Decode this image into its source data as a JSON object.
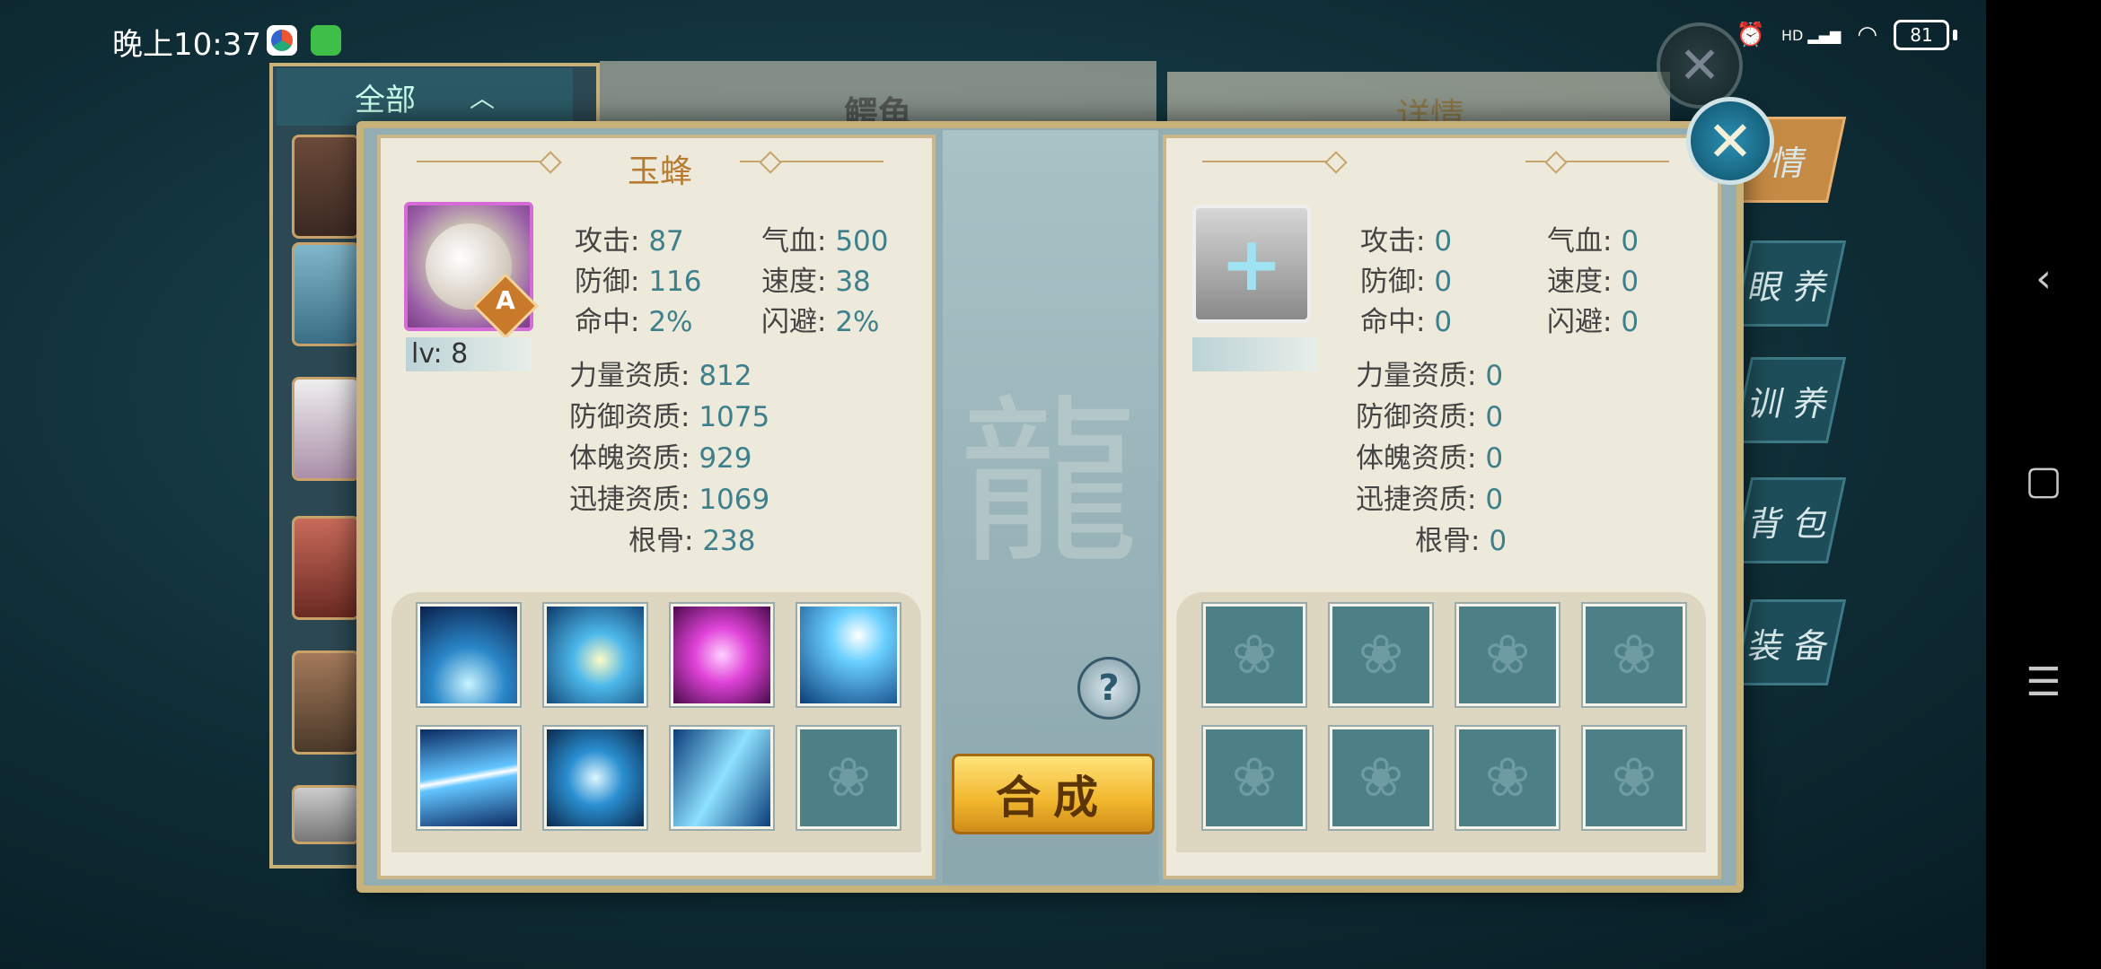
{
  "status_bar": {
    "time": "晚上10:37",
    "signal_label": "HD",
    "battery": "81"
  },
  "navbar": {
    "back": "‹",
    "home": "▢",
    "menu": "☰"
  },
  "background": {
    "filter_label": "全部",
    "middle_title": "鳄龟",
    "right_title": "详情",
    "side_tabs": [
      "情",
      "眼 养",
      "训 养",
      "背 包",
      "装 备"
    ]
  },
  "left_panel": {
    "pet_name": "玉蜂",
    "grade": "A",
    "level": "lv: 8",
    "stats": {
      "attack_label": "攻击:",
      "attack": "87",
      "hp_label": "气血:",
      "hp": "500",
      "defense_label": "防御:",
      "defense": "116",
      "speed_label": "速度:",
      "speed": "38",
      "hit_label": "命中:",
      "hit": "2%",
      "dodge_label": "闪避:",
      "dodge": "2%"
    },
    "aptitudes": {
      "strength_label": "力量资质:",
      "strength": "812",
      "defense_apt_label": "防御资质:",
      "defense_apt": "1075",
      "physique_label": "体魄资质:",
      "physique": "929",
      "agility_label": "迅捷资质:",
      "agility": "1069",
      "bone_label": "根骨:",
      "bone": "238"
    },
    "skills": [
      "ice-burst",
      "shield-strike",
      "pink-vortex",
      "thunder-storm",
      "blade-wind",
      "cross-blade",
      "swift-arrow",
      "empty"
    ]
  },
  "right_panel": {
    "stats": {
      "attack_label": "攻击:",
      "attack": "0",
      "hp_label": "气血:",
      "hp": "0",
      "defense_label": "防御:",
      "defense": "0",
      "speed_label": "速度:",
      "speed": "0",
      "hit_label": "命中:",
      "hit": "0",
      "dodge_label": "闪避:",
      "dodge": "0"
    },
    "aptitudes": {
      "strength_label": "力量资质:",
      "strength": "0",
      "defense_apt_label": "防御资质:",
      "defense_apt": "0",
      "physique_label": "体魄资质:",
      "physique": "0",
      "agility_label": "迅捷资质:",
      "agility": "0",
      "bone_label": "根骨:",
      "bone": "0"
    }
  },
  "center": {
    "help": "?",
    "combine_label": "合成"
  },
  "colors": {
    "accent_gold": "#c9b27a",
    "value_teal": "#3e7f8c",
    "name_orange": "#b67b30",
    "combine_yellow": "#f0b62c"
  }
}
